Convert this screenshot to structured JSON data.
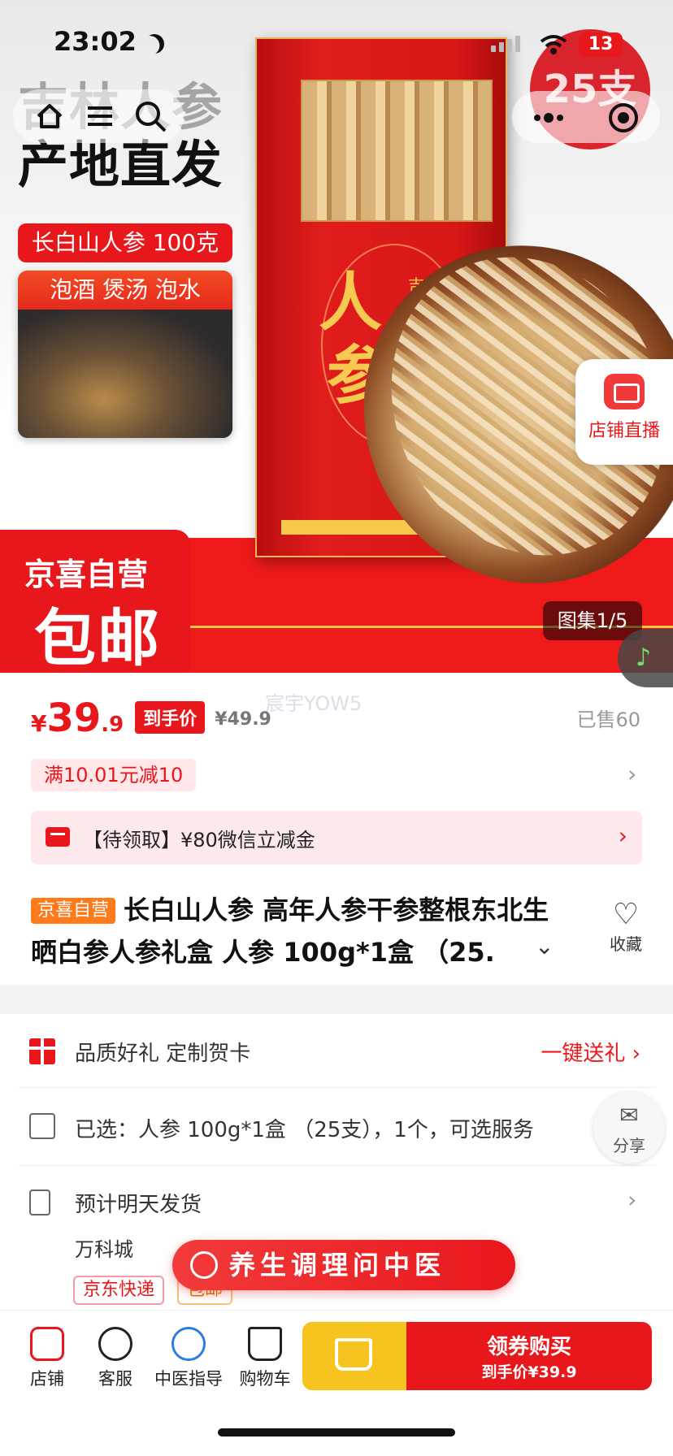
{
  "status_bar": {
    "time": "23:02",
    "battery": "13"
  },
  "hero": {
    "headline_1": "吉林人参",
    "headline_2": "产地直发",
    "tag_1": "长白山人参 100克",
    "card_caption": "泡酒 煲汤 泡水",
    "badge": "25支",
    "box_char_1": "人",
    "box_char_2": "参",
    "box_small": "吉林",
    "promo_top": "京喜自营",
    "promo_big": "包邮",
    "live_label": "店铺直播",
    "gallery_index": "图集1/5"
  },
  "price": {
    "symbol": "¥",
    "integer": "39",
    "decimal": ".9",
    "arrive_tag": "到手价",
    "original": "¥49.9",
    "watermark": "宸宇YOW5",
    "sold": "已售60"
  },
  "coupon": {
    "label": "满10.01元减10"
  },
  "wechat_bar": {
    "text": "【待领取】¥80微信立减金"
  },
  "product": {
    "self_tag": "京喜自营",
    "title": "长白山人参 高年人参干参整根东北生晒白参人参礼盒 人参 100g*1盒 （25.",
    "favorite_label": "收藏"
  },
  "rows": {
    "gift_text": "品质好礼 定制贺卡",
    "gift_action": "一键送礼",
    "selected_text": "已选：人参 100g*1盒 （25支），1个，可选服务",
    "delivery_text": "预计明天发货",
    "address": "万科城",
    "ship_tag_1": "京东快递",
    "ship_tag_2": "包邮"
  },
  "share": {
    "label": "分享"
  },
  "tcm_banner": {
    "text": "养生调理问中医"
  },
  "bottom_bar": {
    "shop": "店铺",
    "service": "客服",
    "tcm": "中医指导",
    "cart": "购物车",
    "buy_main": "领券购买",
    "buy_sub": "到手价¥39.9"
  },
  "colors": {
    "accent": "#e8171c",
    "cart_button": "#f7c31f",
    "tag_orange": "#ff7a1a"
  }
}
